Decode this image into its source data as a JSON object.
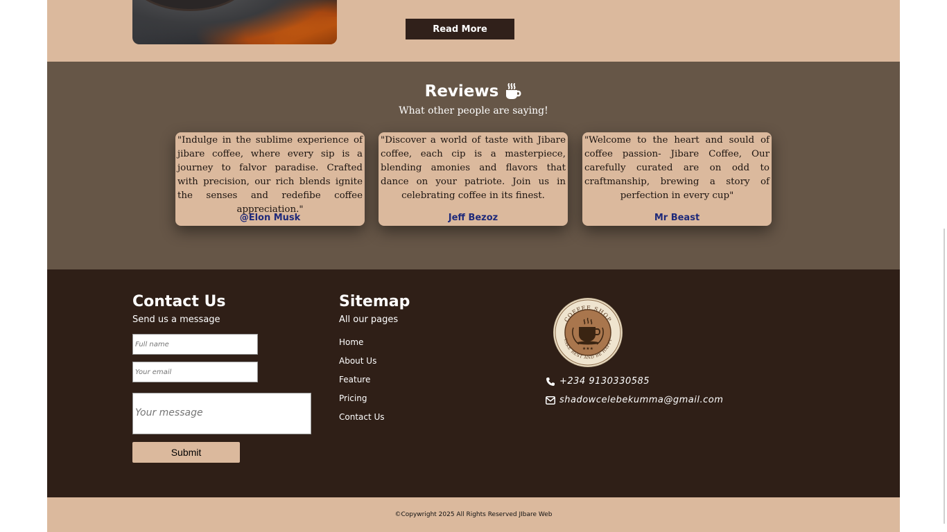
{
  "about": {
    "read_more_label": "Read More"
  },
  "reviews": {
    "title": "Reviews",
    "subtitle": "What other people are saying!",
    "items": [
      {
        "text": "\"Indulge in the sublime experience of jibare coffee, where every sip is a journey to falvor paradise. Crafted with precision, our rich blends ignite the senses and redefibe coffee appreciation.\"",
        "author": "@Elon Musk"
      },
      {
        "text": "\"Discover a world of taste with Jibare coffee, each cip is a masterpiece, blending amonies and flavors that dance on your patriote. Join us in celebrating coffee in its finest.",
        "author": "Jeff Bezoz"
      },
      {
        "text": "\"Welcome to the heart and sould of coffee passion- Jibare Coffee, Our carefully curated are on odd to craftmanship, brewing a story of perfection in every cup\"",
        "author": "Mr Beast"
      }
    ]
  },
  "contact": {
    "title": "Contact Us",
    "subtitle": "Send us a message",
    "name_placeholder": "Full name",
    "email_placeholder": "Your email",
    "message_placeholder": "Your message",
    "submit_label": "Submit"
  },
  "sitemap": {
    "title": "Sitemap",
    "subtitle": "All our pages",
    "links": [
      "Home",
      "About Us",
      "Feature",
      "Pricing",
      "Contact Us"
    ]
  },
  "info": {
    "logo_top_text": "COFFEE SHOP",
    "logo_bottom_text": "TAKE REST AND BE HAPPY",
    "phone": "+234 9130330585",
    "email": "shadowcelebekumma@gmail.com"
  },
  "footer": {
    "copyright": "©Copywright 2025 All Rights Reserved JIbare Web"
  },
  "icons": {
    "reviews": "coffee-cup-icon",
    "phone": "phone-icon",
    "email": "envelope-icon"
  },
  "colors": {
    "tan": "#dbb99d",
    "mocha": "#665647",
    "dark_brown": "#2f1f17",
    "author_blue": "#1f2a7a"
  }
}
